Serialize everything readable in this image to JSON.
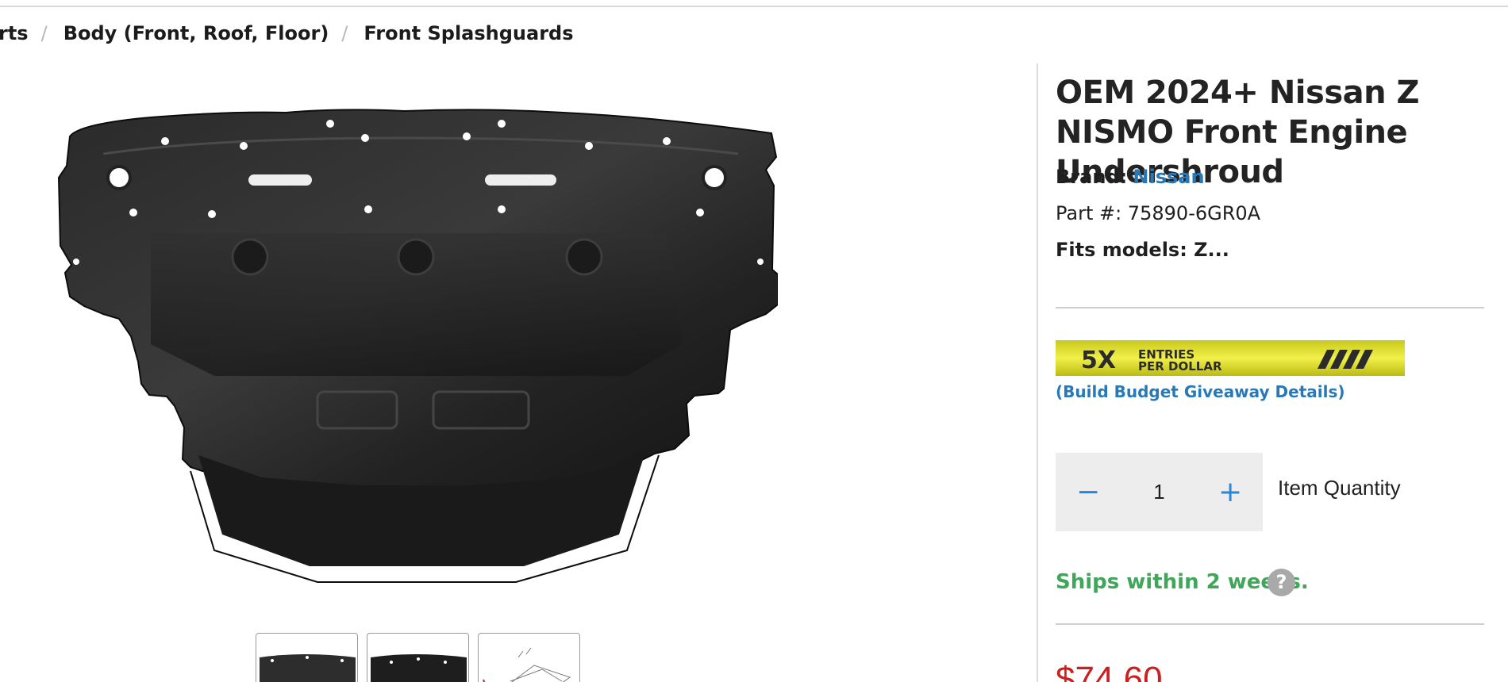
{
  "breadcrumb": {
    "items": [
      "rts",
      "Body (Front, Roof, Floor)",
      "Front Splashguards"
    ],
    "separator": "/"
  },
  "product": {
    "title": "OEM 2024+ Nissan Z NISMO Front Engine Undershroud",
    "brand_label": "Brand:",
    "brand": "Nissan",
    "part_label": "Part #:",
    "part_number": "75890-6GR0A",
    "fits_label": "Fits models:",
    "fits_value": "Z...",
    "image_icon": "engine-undershroud-photo"
  },
  "promo": {
    "banner_text_big": "5X",
    "banner_text_line1": "ENTRIES",
    "banner_text_line2": "PER DOLLAR",
    "banner_color": "#e3e22a",
    "link": "(Build Budget Giveaway Details)"
  },
  "quantity": {
    "minus": "−",
    "value": "1",
    "plus": "+",
    "label": "Item Quantity"
  },
  "shipping": {
    "text": "Ships within 2 weeks.",
    "help": "?"
  },
  "price": {
    "value": "$74.60"
  },
  "colors": {
    "link_blue": "#2a78b5",
    "ship_green": "#3fa65a",
    "price_red": "#cc1f1f",
    "qty_blue": "#2a87d8"
  }
}
